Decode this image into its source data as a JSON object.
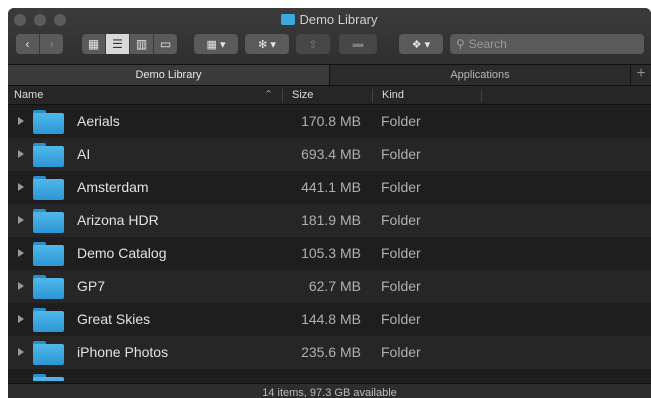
{
  "window": {
    "title": "Demo Library",
    "folder_icon": "folder-icon"
  },
  "toolbar": {
    "back_icon": "‹",
    "forward_icon": "›",
    "view_icon_grid": "▦",
    "view_icon_list": "☰",
    "view_icon_columns": "▥",
    "view_icon_gallery": "▭",
    "arrange_icon": "▦ ▾",
    "action_icon": "✻ ▾",
    "share_icon": "⇧",
    "tags_icon": "▬",
    "dropbox_icon": "❖ ▾",
    "search_placeholder": "Search"
  },
  "tabs": [
    {
      "label": "Demo Library",
      "active": true
    },
    {
      "label": "Applications",
      "active": false
    }
  ],
  "tab_add": "+",
  "columns": {
    "name": "Name",
    "size": "Size",
    "kind": "Kind",
    "sort_indicator": "⌃"
  },
  "rows": [
    {
      "name": "Aerials",
      "size": "170.8 MB",
      "kind": "Folder"
    },
    {
      "name": "AI",
      "size": "693.4 MB",
      "kind": "Folder"
    },
    {
      "name": "Amsterdam",
      "size": "441.1 MB",
      "kind": "Folder"
    },
    {
      "name": "Arizona HDR",
      "size": "181.9 MB",
      "kind": "Folder"
    },
    {
      "name": "Demo Catalog",
      "size": "105.3 MB",
      "kind": "Folder"
    },
    {
      "name": "GP7",
      "size": "62.7 MB",
      "kind": "Folder"
    },
    {
      "name": "Great Skies",
      "size": "144.8 MB",
      "kind": "Folder"
    },
    {
      "name": "iPhone Photos",
      "size": "235.6 MB",
      "kind": "Folder"
    }
  ],
  "status": {
    "text": "14 items, 97.3 GB available"
  },
  "colors": {
    "folder": "#3aa9e0",
    "background": "#1e1e1e"
  }
}
